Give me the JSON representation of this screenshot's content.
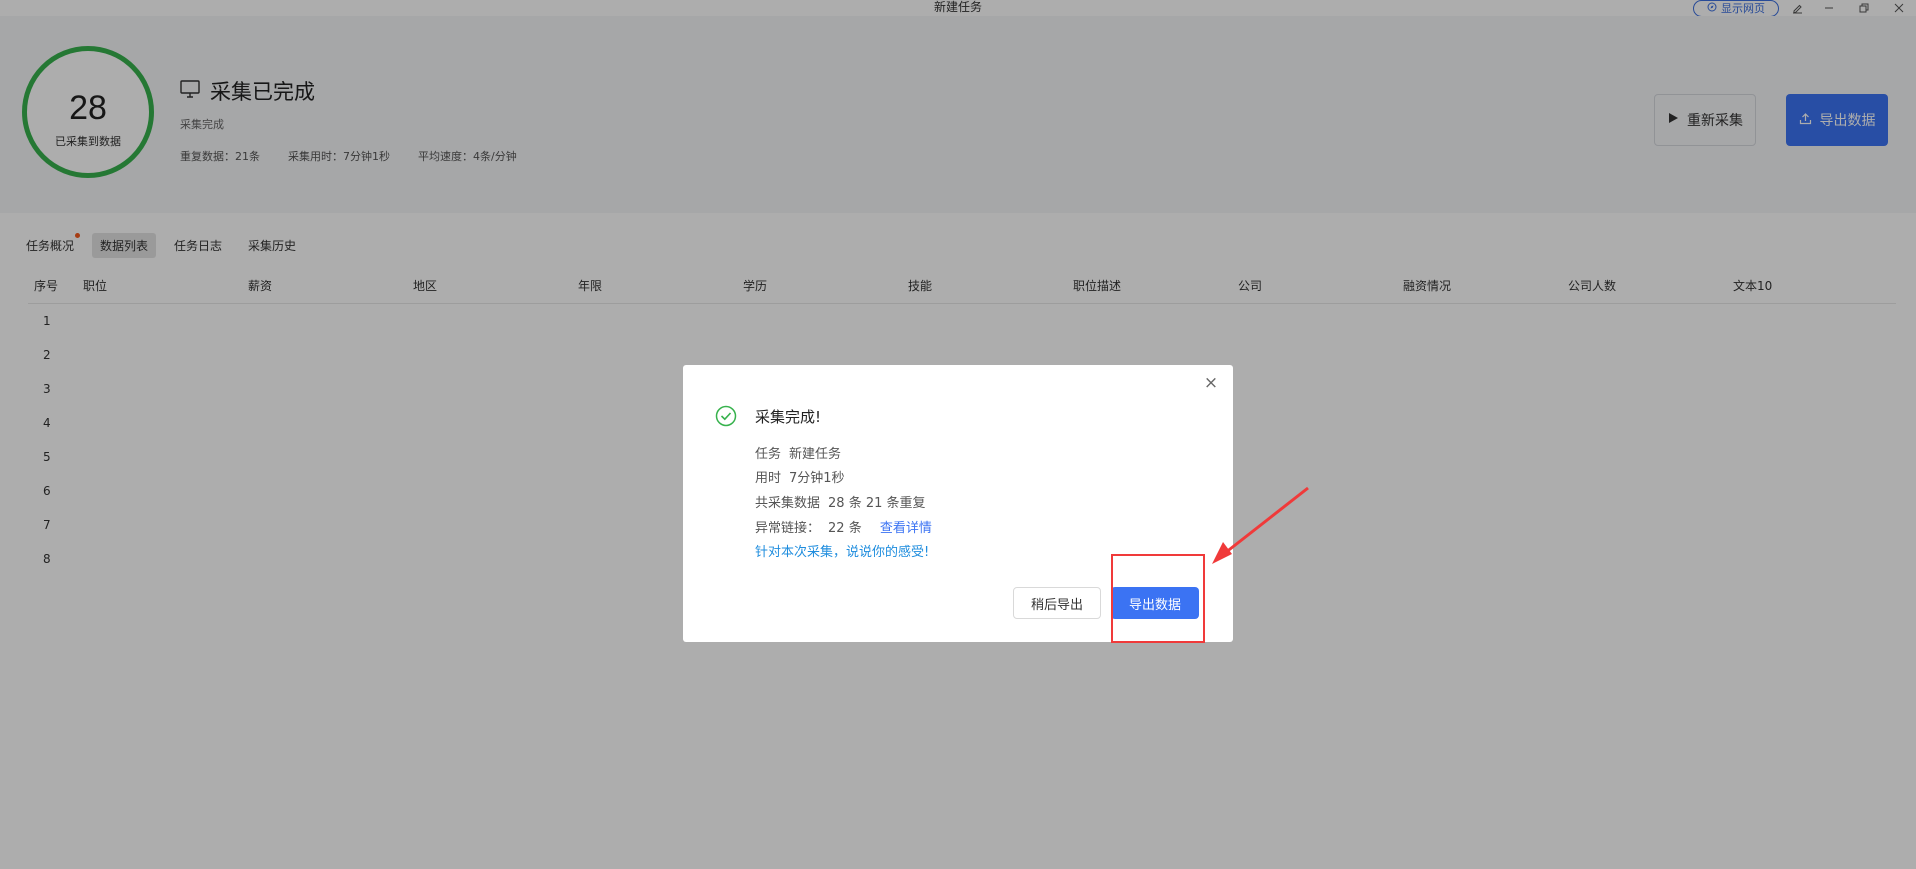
{
  "window": {
    "title": "新建任务",
    "show_web_label": "显示网页"
  },
  "header": {
    "count": "28",
    "count_caption": "已采集到数据",
    "status_title": "采集已完成",
    "status_sub": "采集完成",
    "stats": [
      "重复数据：21条",
      "采集用时：7分钟1秒",
      "平均速度：4条/分钟"
    ],
    "recollect_label": "重新采集",
    "export_label": "导出数据"
  },
  "tabs": [
    {
      "label": "任务概况",
      "has_dot": true
    },
    {
      "label": "数据列表",
      "active": true
    },
    {
      "label": "任务日志"
    },
    {
      "label": "采集历史"
    }
  ],
  "table": {
    "columns": [
      "序号",
      "职位",
      "薪资",
      "地区",
      "年限",
      "学历",
      "技能",
      "职位描述",
      "公司",
      "融资情况",
      "公司人数",
      "文本10"
    ],
    "rows": [
      "1",
      "2",
      "3",
      "4",
      "5",
      "6",
      "7",
      "8"
    ]
  },
  "modal": {
    "title": "采集完成!",
    "task_label": "任务",
    "task_value": "新建任务",
    "time_label": "用时",
    "time_value": "7分钟1秒",
    "total_label": "共采集数据",
    "total_value": "28 条 21 条重复",
    "error_label": "异常链接：",
    "error_value": "22 条",
    "detail_link": "查看详情",
    "feedback": "针对本次采集，说说你的感受!",
    "later_label": "稍后导出",
    "export_label": "导出数据"
  },
  "colors": {
    "accent": "#3b73f3",
    "success": "#37b24d",
    "annotation": "#f03a3a"
  }
}
